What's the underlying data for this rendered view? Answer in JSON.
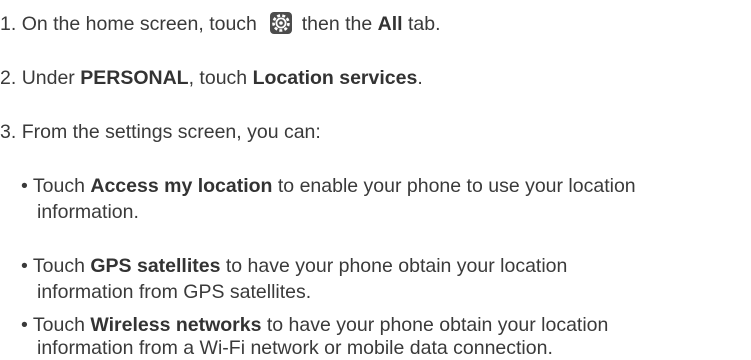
{
  "steps": [
    {
      "number": "1.",
      "text_before": "On the home screen, touch",
      "icon": "settings-gear-icon",
      "text_after": "then the",
      "bold": "All",
      "text_end": "tab."
    },
    {
      "number": "2.",
      "text_before": "Under",
      "bold1": "PERSONAL",
      "text_mid": ", touch",
      "bold2": "Location services",
      "text_end": "."
    },
    {
      "number": "3.",
      "text": "From the settings screen, you can:"
    }
  ],
  "bullets": [
    {
      "bullet": "•",
      "prefix": "Touch",
      "bold": "Access my location",
      "line1": "to enable your phone to use your location",
      "line2": "information."
    },
    {
      "bullet": "•",
      "prefix": "Touch",
      "bold": "GPS satellites",
      "line1": "to have your phone obtain your location",
      "line2": "information from GPS satellites."
    },
    {
      "bullet": "•",
      "prefix": "Touch",
      "bold": "Wireless networks",
      "line1": "to have your phone obtain your location",
      "line2": "information from a Wi-Fi network or mobile data connection."
    }
  ]
}
